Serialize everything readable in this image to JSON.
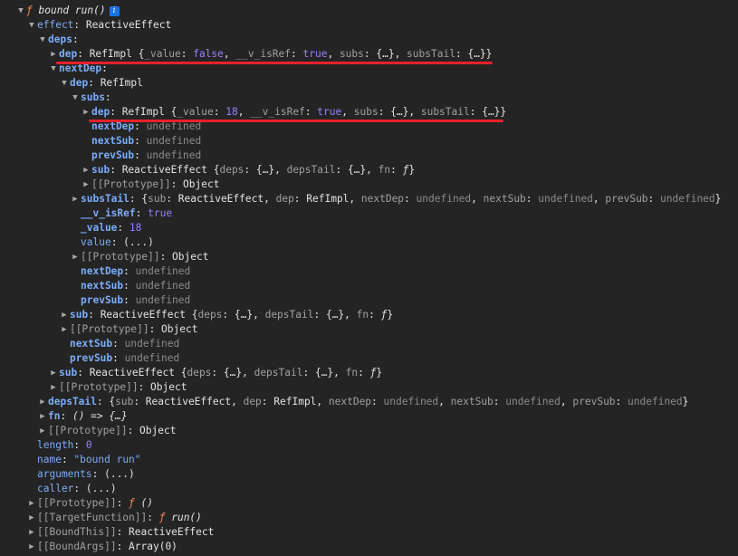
{
  "rows": [
    {
      "indent": 0,
      "tw": "down",
      "parts": [
        {
          "t": "ƒ ",
          "c": "fsym"
        },
        {
          "t": "bound run()",
          "c": "fname"
        }
      ],
      "badge": "i"
    },
    {
      "indent": 1,
      "tw": "down",
      "parts": [
        {
          "t": "effect",
          "c": "key-plain"
        },
        {
          "t": ": ReactiveEffect",
          "c": "preview"
        }
      ]
    },
    {
      "indent": 2,
      "tw": "down",
      "parts": [
        {
          "t": "deps",
          "c": "key-own"
        },
        {
          "t": ":",
          "c": "preview"
        }
      ]
    },
    {
      "indent": 3,
      "tw": "right",
      "underline": "a",
      "parts": [
        {
          "t": "dep",
          "c": "key-own"
        },
        {
          "t": ": RefImpl {",
          "c": "preview"
        },
        {
          "t": "_value",
          "c": "key-dim"
        },
        {
          "t": ": ",
          "c": "preview"
        },
        {
          "t": "false",
          "c": "bool"
        },
        {
          "t": ", ",
          "c": "preview"
        },
        {
          "t": "__v_isRef",
          "c": "key-dim"
        },
        {
          "t": ": ",
          "c": "preview"
        },
        {
          "t": "true",
          "c": "bool"
        },
        {
          "t": ", ",
          "c": "preview"
        },
        {
          "t": "subs",
          "c": "key-dim"
        },
        {
          "t": ": {…}, ",
          "c": "preview"
        },
        {
          "t": "subsTail",
          "c": "key-dim"
        },
        {
          "t": ": {…}}",
          "c": "preview"
        }
      ]
    },
    {
      "indent": 3,
      "tw": "down",
      "parts": [
        {
          "t": "nextDep",
          "c": "key-own"
        },
        {
          "t": ":",
          "c": "preview"
        }
      ]
    },
    {
      "indent": 4,
      "tw": "down",
      "parts": [
        {
          "t": "dep",
          "c": "key-own"
        },
        {
          "t": ": RefImpl",
          "c": "preview"
        }
      ]
    },
    {
      "indent": 5,
      "tw": "down",
      "parts": [
        {
          "t": "subs",
          "c": "key-own"
        },
        {
          "t": ":",
          "c": "preview"
        }
      ]
    },
    {
      "indent": 6,
      "tw": "right",
      "underline": "b",
      "parts": [
        {
          "t": "dep",
          "c": "key-own"
        },
        {
          "t": ": RefImpl {",
          "c": "preview"
        },
        {
          "t": "_value",
          "c": "key-dim"
        },
        {
          "t": ": ",
          "c": "preview"
        },
        {
          "t": "18",
          "c": "num"
        },
        {
          "t": ", ",
          "c": "preview"
        },
        {
          "t": "__v_isRef",
          "c": "key-dim"
        },
        {
          "t": ": ",
          "c": "preview"
        },
        {
          "t": "true",
          "c": "bool"
        },
        {
          "t": ", ",
          "c": "preview"
        },
        {
          "t": "subs",
          "c": "key-dim"
        },
        {
          "t": ": {…}, ",
          "c": "preview"
        },
        {
          "t": "subsTail",
          "c": "key-dim"
        },
        {
          "t": ": {…}}",
          "c": "preview"
        }
      ]
    },
    {
      "indent": 6,
      "tw": "none",
      "parts": [
        {
          "t": "nextDep",
          "c": "key-own"
        },
        {
          "t": ": ",
          "c": "preview"
        },
        {
          "t": "undefined",
          "c": "undef"
        }
      ]
    },
    {
      "indent": 6,
      "tw": "none",
      "parts": [
        {
          "t": "nextSub",
          "c": "key-own"
        },
        {
          "t": ": ",
          "c": "preview"
        },
        {
          "t": "undefined",
          "c": "undef"
        }
      ]
    },
    {
      "indent": 6,
      "tw": "none",
      "parts": [
        {
          "t": "prevSub",
          "c": "key-own"
        },
        {
          "t": ": ",
          "c": "preview"
        },
        {
          "t": "undefined",
          "c": "undef"
        }
      ]
    },
    {
      "indent": 6,
      "tw": "right",
      "parts": [
        {
          "t": "sub",
          "c": "key-own"
        },
        {
          "t": ": ReactiveEffect {",
          "c": "preview"
        },
        {
          "t": "deps",
          "c": "key-dim"
        },
        {
          "t": ": {…}, ",
          "c": "preview"
        },
        {
          "t": "depsTail",
          "c": "key-dim"
        },
        {
          "t": ": {…}, ",
          "c": "preview"
        },
        {
          "t": "fn",
          "c": "key-dim"
        },
        {
          "t": ": ",
          "c": "preview"
        },
        {
          "t": "ƒ",
          "c": "fname"
        },
        {
          "t": "}",
          "c": "preview"
        }
      ]
    },
    {
      "indent": 6,
      "tw": "right",
      "parts": [
        {
          "t": "[[Prototype]]",
          "c": "key-dim"
        },
        {
          "t": ": Object",
          "c": "preview"
        }
      ]
    },
    {
      "indent": 5,
      "tw": "right",
      "parts": [
        {
          "t": "subsTail",
          "c": "key-own"
        },
        {
          "t": ": {",
          "c": "preview"
        },
        {
          "t": "sub",
          "c": "key-dim"
        },
        {
          "t": ": ReactiveEffect, ",
          "c": "preview"
        },
        {
          "t": "dep",
          "c": "key-dim"
        },
        {
          "t": ": RefImpl, ",
          "c": "preview"
        },
        {
          "t": "nextDep",
          "c": "key-dim"
        },
        {
          "t": ": ",
          "c": "preview"
        },
        {
          "t": "undefined",
          "c": "undef"
        },
        {
          "t": ", ",
          "c": "preview"
        },
        {
          "t": "nextSub",
          "c": "key-dim"
        },
        {
          "t": ": ",
          "c": "preview"
        },
        {
          "t": "undefined",
          "c": "undef"
        },
        {
          "t": ", ",
          "c": "preview"
        },
        {
          "t": "prevSub",
          "c": "key-dim"
        },
        {
          "t": ": ",
          "c": "preview"
        },
        {
          "t": "undefined",
          "c": "undef"
        },
        {
          "t": "}",
          "c": "preview"
        }
      ]
    },
    {
      "indent": 5,
      "tw": "none",
      "parts": [
        {
          "t": "__v_isRef",
          "c": "key-own"
        },
        {
          "t": ": ",
          "c": "preview"
        },
        {
          "t": "true",
          "c": "bool"
        }
      ]
    },
    {
      "indent": 5,
      "tw": "none",
      "parts": [
        {
          "t": "_value",
          "c": "key-own"
        },
        {
          "t": ": ",
          "c": "preview"
        },
        {
          "t": "18",
          "c": "num"
        }
      ]
    },
    {
      "indent": 5,
      "tw": "none",
      "parts": [
        {
          "t": "value",
          "c": "key-plain"
        },
        {
          "t": ": (...)",
          "c": "preview"
        }
      ]
    },
    {
      "indent": 5,
      "tw": "right",
      "parts": [
        {
          "t": "[[Prototype]]",
          "c": "key-dim"
        },
        {
          "t": ": Object",
          "c": "preview"
        }
      ]
    },
    {
      "indent": 5,
      "tw": "none",
      "parts": [
        {
          "t": "nextDep",
          "c": "key-own"
        },
        {
          "t": ": ",
          "c": "preview"
        },
        {
          "t": "undefined",
          "c": "undef"
        }
      ]
    },
    {
      "indent": 5,
      "tw": "none",
      "parts": [
        {
          "t": "nextSub",
          "c": "key-own"
        },
        {
          "t": ": ",
          "c": "preview"
        },
        {
          "t": "undefined",
          "c": "undef"
        }
      ]
    },
    {
      "indent": 5,
      "tw": "none",
      "parts": [
        {
          "t": "prevSub",
          "c": "key-own"
        },
        {
          "t": ": ",
          "c": "preview"
        },
        {
          "t": "undefined",
          "c": "undef"
        }
      ]
    },
    {
      "indent": 4,
      "tw": "right",
      "parts": [
        {
          "t": "sub",
          "c": "key-own"
        },
        {
          "t": ": ReactiveEffect {",
          "c": "preview"
        },
        {
          "t": "deps",
          "c": "key-dim"
        },
        {
          "t": ": {…}, ",
          "c": "preview"
        },
        {
          "t": "depsTail",
          "c": "key-dim"
        },
        {
          "t": ": {…}, ",
          "c": "preview"
        },
        {
          "t": "fn",
          "c": "key-dim"
        },
        {
          "t": ": ",
          "c": "preview"
        },
        {
          "t": "ƒ",
          "c": "fname"
        },
        {
          "t": "}",
          "c": "preview"
        }
      ]
    },
    {
      "indent": 4,
      "tw": "right",
      "parts": [
        {
          "t": "[[Prototype]]",
          "c": "key-dim"
        },
        {
          "t": ": Object",
          "c": "preview"
        }
      ]
    },
    {
      "indent": 4,
      "tw": "none",
      "parts": [
        {
          "t": "nextSub",
          "c": "key-own"
        },
        {
          "t": ": ",
          "c": "preview"
        },
        {
          "t": "undefined",
          "c": "undef"
        }
      ]
    },
    {
      "indent": 4,
      "tw": "none",
      "parts": [
        {
          "t": "prevSub",
          "c": "key-own"
        },
        {
          "t": ": ",
          "c": "preview"
        },
        {
          "t": "undefined",
          "c": "undef"
        }
      ]
    },
    {
      "indent": 3,
      "tw": "right",
      "parts": [
        {
          "t": "sub",
          "c": "key-own"
        },
        {
          "t": ": ReactiveEffect {",
          "c": "preview"
        },
        {
          "t": "deps",
          "c": "key-dim"
        },
        {
          "t": ": {…}, ",
          "c": "preview"
        },
        {
          "t": "depsTail",
          "c": "key-dim"
        },
        {
          "t": ": {…}, ",
          "c": "preview"
        },
        {
          "t": "fn",
          "c": "key-dim"
        },
        {
          "t": ": ",
          "c": "preview"
        },
        {
          "t": "ƒ",
          "c": "fname"
        },
        {
          "t": "}",
          "c": "preview"
        }
      ]
    },
    {
      "indent": 3,
      "tw": "right",
      "parts": [
        {
          "t": "[[Prototype]]",
          "c": "key-dim"
        },
        {
          "t": ": Object",
          "c": "preview"
        }
      ]
    },
    {
      "indent": 2,
      "tw": "right",
      "parts": [
        {
          "t": "depsTail",
          "c": "key-own"
        },
        {
          "t": ": {",
          "c": "preview"
        },
        {
          "t": "sub",
          "c": "key-dim"
        },
        {
          "t": ": ReactiveEffect, ",
          "c": "preview"
        },
        {
          "t": "dep",
          "c": "key-dim"
        },
        {
          "t": ": RefImpl, ",
          "c": "preview"
        },
        {
          "t": "nextDep",
          "c": "key-dim"
        },
        {
          "t": ": ",
          "c": "preview"
        },
        {
          "t": "undefined",
          "c": "undef"
        },
        {
          "t": ", ",
          "c": "preview"
        },
        {
          "t": "nextSub",
          "c": "key-dim"
        },
        {
          "t": ": ",
          "c": "preview"
        },
        {
          "t": "undefined",
          "c": "undef"
        },
        {
          "t": ", ",
          "c": "preview"
        },
        {
          "t": "prevSub",
          "c": "key-dim"
        },
        {
          "t": ": ",
          "c": "preview"
        },
        {
          "t": "undefined",
          "c": "undef"
        },
        {
          "t": "}",
          "c": "preview"
        }
      ]
    },
    {
      "indent": 2,
      "tw": "right",
      "parts": [
        {
          "t": "fn",
          "c": "key-own"
        },
        {
          "t": ": ",
          "c": "preview"
        },
        {
          "t": "() => {…}",
          "c": "fname"
        }
      ]
    },
    {
      "indent": 2,
      "tw": "right",
      "parts": [
        {
          "t": "[[Prototype]]",
          "c": "key-dim"
        },
        {
          "t": ": Object",
          "c": "preview"
        }
      ]
    },
    {
      "indent": 1,
      "tw": "none",
      "parts": [
        {
          "t": "length",
          "c": "key-plain"
        },
        {
          "t": ": ",
          "c": "preview"
        },
        {
          "t": "0",
          "c": "num"
        }
      ]
    },
    {
      "indent": 1,
      "tw": "none",
      "parts": [
        {
          "t": "name",
          "c": "key-plain"
        },
        {
          "t": ": ",
          "c": "preview"
        },
        {
          "t": "\"bound run\"",
          "c": "str"
        }
      ]
    },
    {
      "indent": 1,
      "tw": "none",
      "parts": [
        {
          "t": "arguments",
          "c": "key-plain"
        },
        {
          "t": ": (...)",
          "c": "preview"
        }
      ]
    },
    {
      "indent": 1,
      "tw": "none",
      "parts": [
        {
          "t": "caller",
          "c": "key-plain"
        },
        {
          "t": ": (...)",
          "c": "preview"
        }
      ]
    },
    {
      "indent": 1,
      "tw": "right",
      "parts": [
        {
          "t": "[[Prototype]]",
          "c": "key-dim"
        },
        {
          "t": ": ",
          "c": "preview"
        },
        {
          "t": "ƒ",
          "c": "fsym"
        },
        {
          "t": " ()",
          "c": "fname"
        }
      ]
    },
    {
      "indent": 1,
      "tw": "right",
      "parts": [
        {
          "t": "[[TargetFunction]]",
          "c": "key-dim"
        },
        {
          "t": ": ",
          "c": "preview"
        },
        {
          "t": "ƒ",
          "c": "fsym"
        },
        {
          "t": " run()",
          "c": "fname"
        }
      ]
    },
    {
      "indent": 1,
      "tw": "right",
      "parts": [
        {
          "t": "[[BoundThis]]",
          "c": "key-dim"
        },
        {
          "t": ": ReactiveEffect",
          "c": "preview"
        }
      ]
    },
    {
      "indent": 1,
      "tw": "right",
      "parts": [
        {
          "t": "[[BoundArgs]]",
          "c": "key-dim"
        },
        {
          "t": ": Array(0)",
          "c": "preview"
        }
      ]
    }
  ],
  "colors": {
    "annotation": "#e8202a",
    "background": "#242424"
  }
}
